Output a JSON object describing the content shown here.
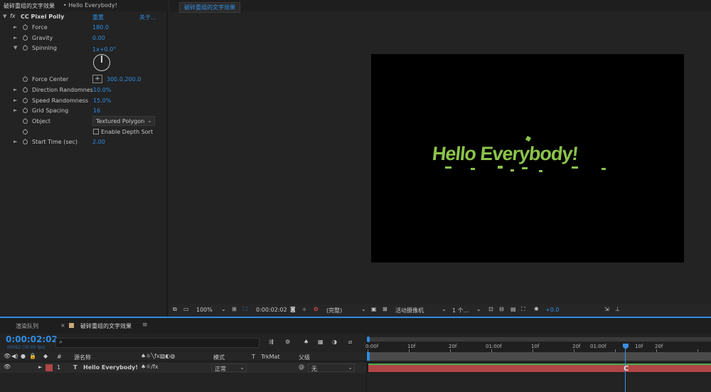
{
  "effects_panel": {
    "tab_title": "破碎重组的文字效果",
    "tab_subtitle": "• Hello Everybody!",
    "effect_name": "CC Pixel Polly",
    "reset_label": "重置",
    "about_label": "关于…",
    "fx_icon_label": "fx",
    "properties": [
      {
        "label": "Force",
        "value": "180.0"
      },
      {
        "label": "Gravity",
        "value": "0.00"
      },
      {
        "label": "Spinning",
        "value": "1x+0.0°"
      },
      {
        "label": "Force Center",
        "value": "300.0,200.0"
      },
      {
        "label": "Direction Randomnes",
        "value": "10.0%"
      },
      {
        "label": "Speed Randomness",
        "value": "15.0%"
      },
      {
        "label": "Grid Spacing",
        "value": "16"
      },
      {
        "label": "Object",
        "value": "Textured Polygon"
      },
      {
        "label": "Enable Depth Sort",
        "value": ""
      },
      {
        "label": "Start Time (sec)",
        "value": "2.00"
      }
    ]
  },
  "comp_viewer": {
    "tab_label": "破碎重组的文字效果",
    "canvas_text": "Hello Everybody!",
    "text_color": "#8bc34a",
    "toolbar": {
      "zoom": "100%",
      "timecode": "0:00:02:02",
      "resolution": "(完整)",
      "camera": "活动摄像机",
      "views": "1 个…",
      "exposure": "+0.0"
    }
  },
  "timeline": {
    "tab_render_queue": "渲染队列",
    "tab_comp": "破碎重组的文字效果",
    "timecode": "0:00:02:02",
    "frame_info": "00062 (30.00 fps)",
    "search_placeholder": "",
    "headers": {
      "num": "#",
      "source_name": "源名称",
      "mode": "模式",
      "t": "T",
      "trkmat": "TrkMat",
      "parent": "父级"
    },
    "layer": {
      "num": "1",
      "type_glyph": "T",
      "name": "Hello Everybody!",
      "mode": "正常",
      "parent": "无"
    },
    "ruler_labels": [
      "0:00f",
      "10f",
      "20f",
      "01:00f",
      "10f",
      "20f",
      "01:00f",
      "10f",
      "20f"
    ],
    "playhead_marker": "C",
    "colors": {
      "layer_bar": "#b04646",
      "playhead": "#3a8ee6",
      "work_area": "#4a4a4a"
    }
  }
}
